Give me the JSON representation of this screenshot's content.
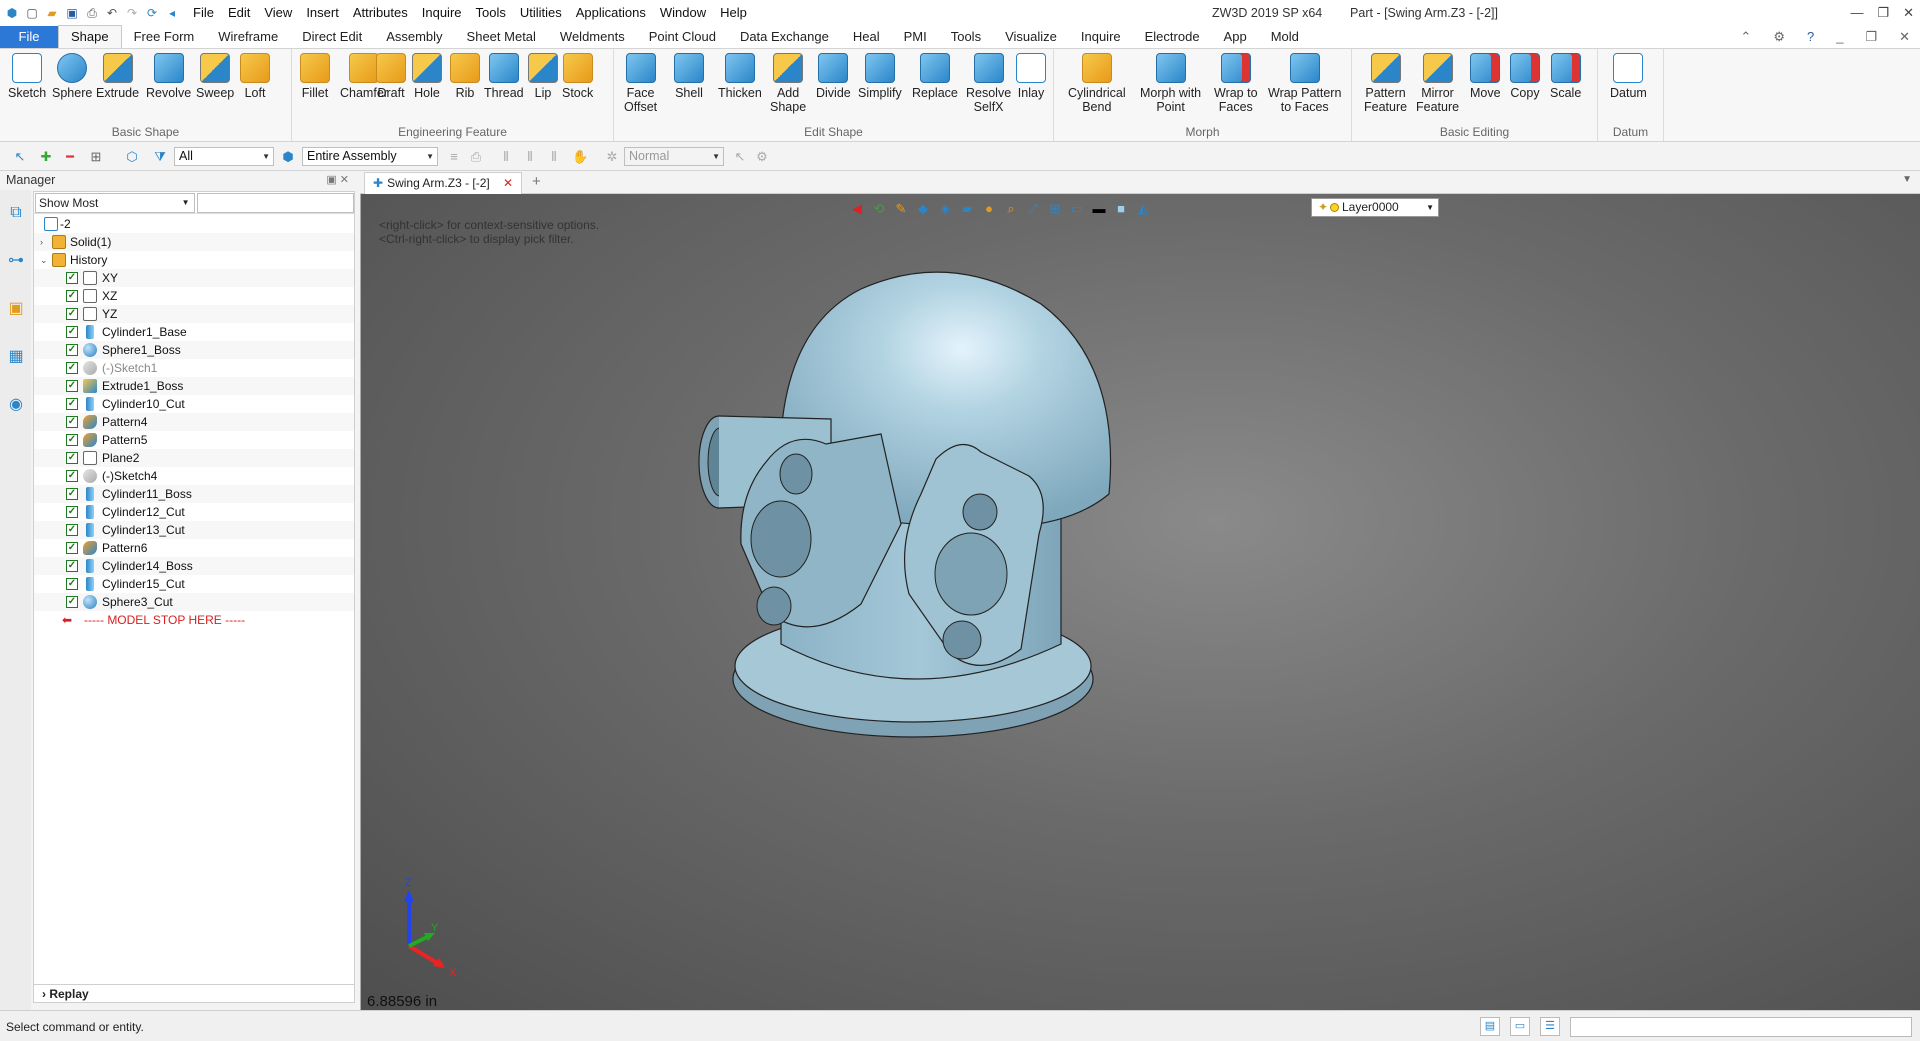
{
  "app": {
    "window_title": "ZW3D 2019 SP x64",
    "doc_title": "Part - [Swing Arm.Z3 - [-2]]"
  },
  "menu": [
    "File",
    "Edit",
    "View",
    "Insert",
    "Attributes",
    "Inquire",
    "Tools",
    "Utilities",
    "Applications",
    "Window",
    "Help"
  ],
  "ribbon_tabs": [
    "File",
    "Shape",
    "Free Form",
    "Wireframe",
    "Direct Edit",
    "Assembly",
    "Sheet Metal",
    "Weldments",
    "Point Cloud",
    "Data Exchange",
    "Heal",
    "PMI",
    "Tools",
    "Visualize",
    "Inquire",
    "Electrode",
    "App",
    "Mold"
  ],
  "ribbon": {
    "basic_shape": {
      "label": "Basic Shape",
      "buttons": [
        "Sketch",
        "Sphere",
        "Extrude",
        "Revolve",
        "Sweep",
        "Loft"
      ]
    },
    "engineering_feature": {
      "label": "Engineering Feature",
      "buttons": [
        "Fillet",
        "Chamfer",
        "Draft",
        "Hole",
        "Rib",
        "Thread",
        "Lip",
        "Stock"
      ]
    },
    "edit_shape": {
      "label": "Edit Shape",
      "buttons": [
        "Face\nOffset",
        "Shell",
        "Thicken",
        "Add\nShape",
        "Divide",
        "Simplify",
        "Replace",
        "Resolve\nSelfX",
        "Inlay"
      ]
    },
    "morph": {
      "label": "Morph",
      "buttons": [
        "Cylindrical\nBend",
        "Morph with\nPoint",
        "Wrap to\nFaces",
        "Wrap Pattern\nto Faces"
      ]
    },
    "basic_editing": {
      "label": "Basic Editing",
      "buttons": [
        "Pattern\nFeature",
        "Mirror\nFeature",
        "Move",
        "Copy",
        "Scale"
      ]
    },
    "datum": {
      "label": "Datum",
      "buttons": [
        "Datum"
      ]
    }
  },
  "toolbar2": {
    "filter_value": "All",
    "scope_value": "Entire Assembly",
    "mode_value": "Normal"
  },
  "manager": {
    "title": "Manager",
    "filter_value": "Show Most",
    "tree": [
      {
        "label": "-2",
        "indent": 0,
        "type": "root"
      },
      {
        "label": "Solid(1)",
        "indent": 1,
        "type": "solid",
        "expander": "›"
      },
      {
        "label": "History",
        "indent": 1,
        "type": "hist",
        "expander": "⌄"
      },
      {
        "label": "XY",
        "type": "datum"
      },
      {
        "label": "XZ",
        "type": "datum"
      },
      {
        "label": "YZ",
        "type": "datum"
      },
      {
        "label": "Cylinder1_Base",
        "type": "cyl"
      },
      {
        "label": "Sphere1_Boss",
        "type": "sph"
      },
      {
        "label": "(-)Sketch1",
        "type": "sk",
        "dim": true
      },
      {
        "label": "Extrude1_Boss",
        "type": "ext"
      },
      {
        "label": "Cylinder10_Cut",
        "type": "cyl"
      },
      {
        "label": "Pattern4",
        "type": "pat"
      },
      {
        "label": "Pattern5",
        "type": "pat"
      },
      {
        "label": "Plane2",
        "type": "datum"
      },
      {
        "label": "(-)Sketch4",
        "type": "sk"
      },
      {
        "label": "Cylinder11_Boss",
        "type": "cyl"
      },
      {
        "label": "Cylinder12_Cut",
        "type": "cyl"
      },
      {
        "label": "Cylinder13_Cut",
        "type": "cyl"
      },
      {
        "label": "Pattern6",
        "type": "pat"
      },
      {
        "label": "Cylinder14_Boss",
        "type": "cyl"
      },
      {
        "label": "Cylinder15_Cut",
        "type": "cyl"
      },
      {
        "label": "Sphere3_Cut",
        "type": "sph"
      },
      {
        "label": "----- MODEL STOP HERE -----",
        "type": "stop"
      }
    ],
    "replay_label": "Replay"
  },
  "doc_tab": {
    "label": "Swing Arm.Z3 - [-2]"
  },
  "viewport": {
    "hint_line1": "<right-click> for context-sensitive options.",
    "hint_line2": "<Ctrl-right-click> to display pick filter.",
    "layer": "Layer0000",
    "scale_readout": "6.88596 in",
    "triad": {
      "x": "X",
      "y": "Y",
      "z": "Z"
    }
  },
  "status": {
    "text": "Select command or entity."
  }
}
